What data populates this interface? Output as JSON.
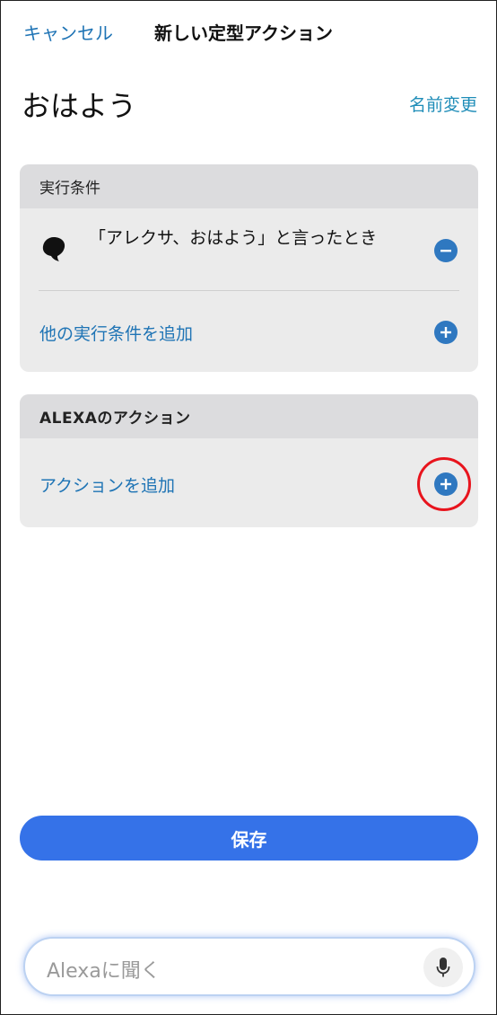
{
  "header": {
    "cancel_label": "キャンセル",
    "title": "新しい定型アクション"
  },
  "routine": {
    "name": "おはよう",
    "rename_label": "名前変更"
  },
  "conditions_card": {
    "heading": "実行条件",
    "trigger_icon": "speech-bubble-icon",
    "trigger_text": "「アレクサ、おはよう」と言ったとき",
    "remove_icon": "minus-circle-icon",
    "add_label": "他の実行条件を追加",
    "add_icon": "plus-circle-icon"
  },
  "actions_card": {
    "heading": "ALEXAのアクション",
    "add_label": "アクションを追加",
    "add_icon": "plus-circle-icon"
  },
  "save_label": "保存",
  "alexa_bar": {
    "placeholder": "Alexaに聞く",
    "mic_icon": "microphone-icon"
  },
  "colors": {
    "link_blue": "#1f74b5",
    "icon_blue": "#2f78c0",
    "save_blue": "#3572e8",
    "card_bg": "#ebebeb",
    "card_header_bg": "#dcdcde",
    "highlight_red": "#e8141d"
  }
}
